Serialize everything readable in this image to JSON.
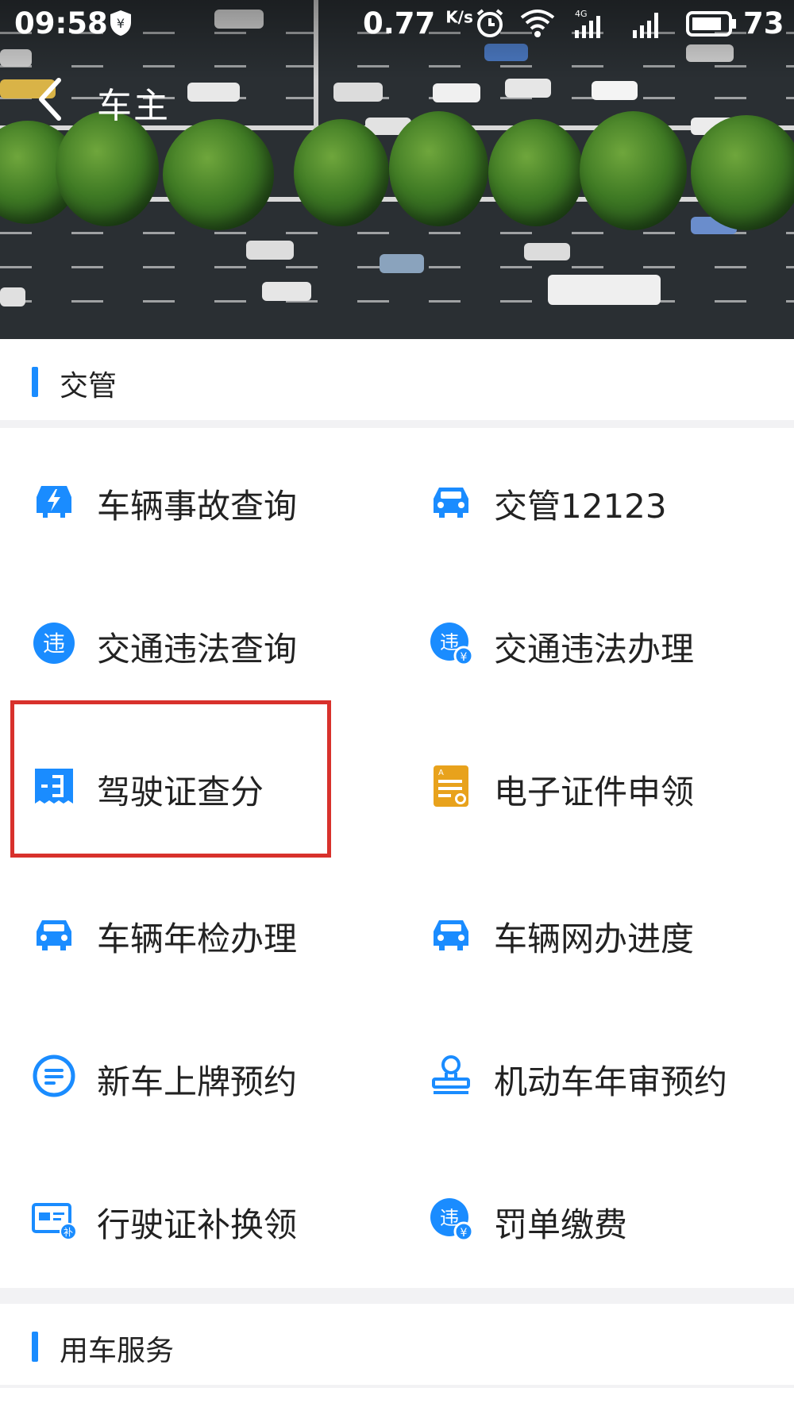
{
  "status_bar": {
    "time": "09:58",
    "net_speed": "0.77",
    "net_unit": "K/s",
    "network_label": "4G",
    "battery": "73"
  },
  "nav": {
    "title": "车主"
  },
  "sections": [
    {
      "title": "交管"
    },
    {
      "title": "用车服务"
    }
  ],
  "grid": [
    {
      "label": "车辆事故查询",
      "icon": "car-lightning-icon"
    },
    {
      "label": "交管12123",
      "icon": "car-icon"
    },
    {
      "label": "交通违法查询",
      "icon": "violation-badge-icon"
    },
    {
      "label": "交通违法办理",
      "icon": "violation-pay-icon"
    },
    {
      "label": "驾驶证查分",
      "icon": "license-score-icon"
    },
    {
      "label": "电子证件申领",
      "icon": "e-certificate-icon"
    },
    {
      "label": "车辆年检办理",
      "icon": "car-icon"
    },
    {
      "label": "车辆网办进度",
      "icon": "car-icon"
    },
    {
      "label": "新车上牌预约",
      "icon": "list-circle-icon"
    },
    {
      "label": "机动车年审预约",
      "icon": "stamp-icon"
    },
    {
      "label": "行驶证补换领",
      "icon": "card-replace-icon"
    },
    {
      "label": "罚单缴费",
      "icon": "violation-pay-icon"
    }
  ],
  "colors": {
    "accent": "#1a8cff",
    "highlight": "#d8312c",
    "gold": "#e8a21c"
  }
}
